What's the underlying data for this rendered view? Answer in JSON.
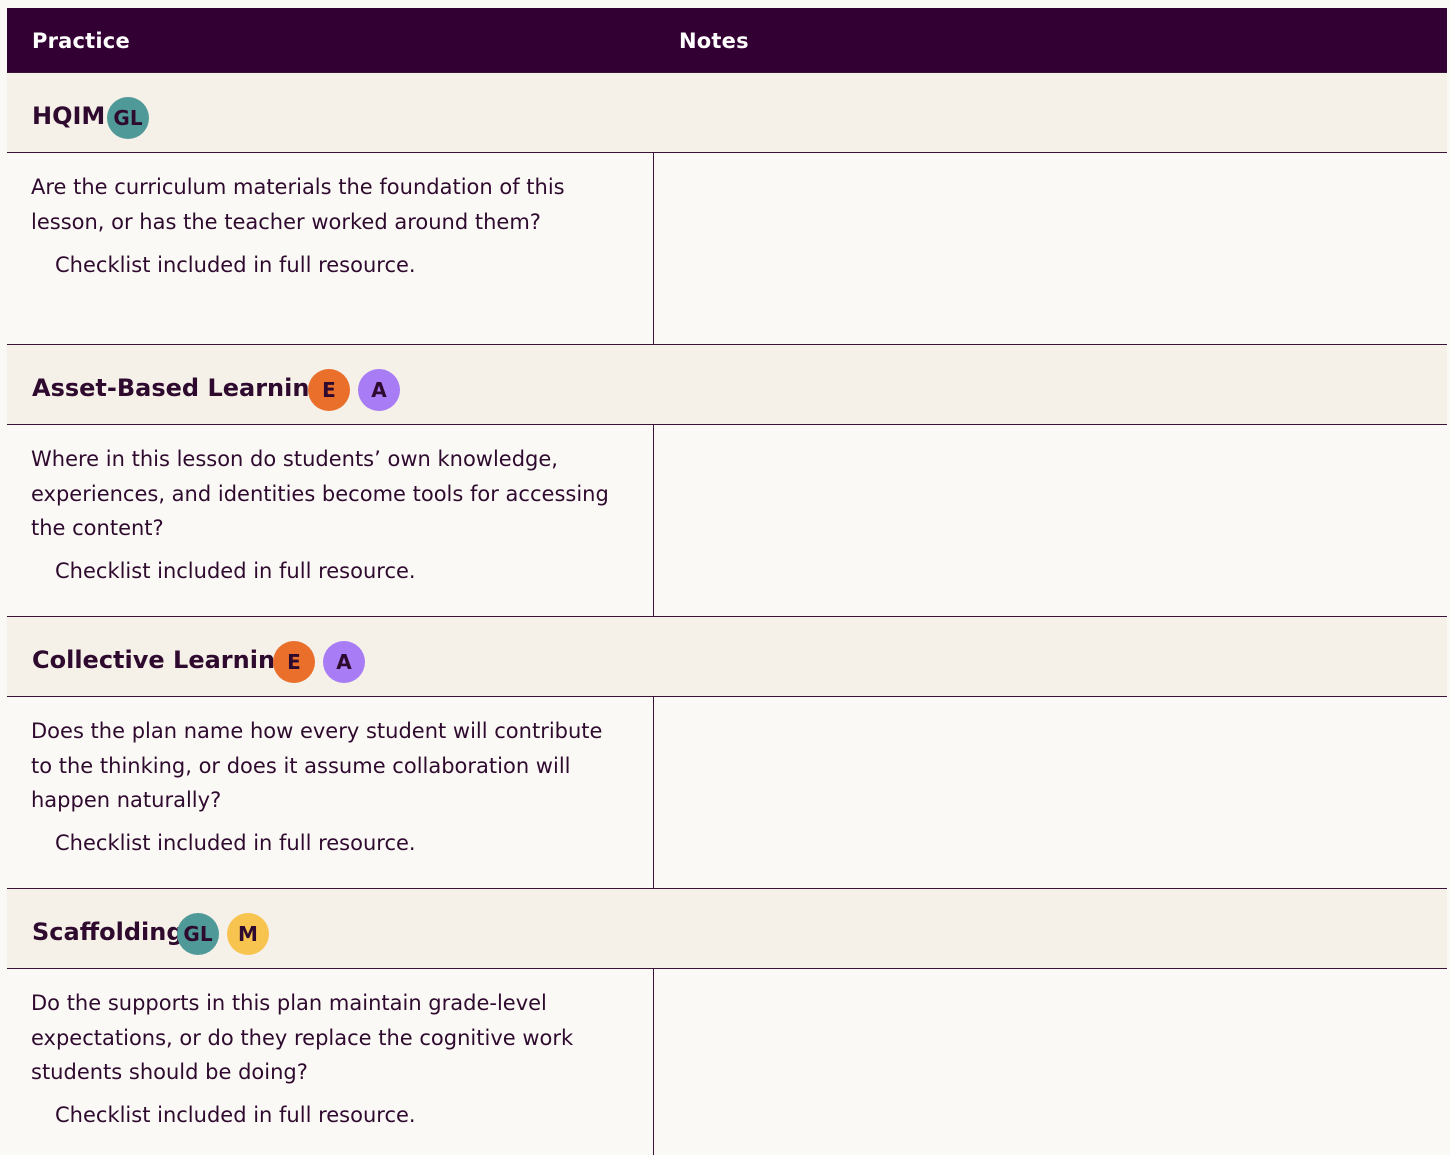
{
  "table": {
    "headers": {
      "practice": "Practice",
      "notes": "Notes"
    },
    "rows": [
      {
        "title": "HQIM",
        "badges": [
          {
            "label": "GL",
            "color": "#4f9998"
          }
        ],
        "question": "Are the curriculum materials the foundation of this lesson, or has the teacher worked around them?",
        "checklist": "Checklist included in full resource.",
        "notes": ""
      },
      {
        "title": "Asset-Based Learning",
        "badges": [
          {
            "label": "E",
            "color": "#e96f2b"
          },
          {
            "label": "A",
            "color": "#a77cf5"
          }
        ],
        "question": "Where in this lesson do students’ own knowledge, experiences, and identities become tools for accessing the content?",
        "checklist": "Checklist included in full resource.",
        "notes": ""
      },
      {
        "title": "Collective Learning",
        "badges": [
          {
            "label": "E",
            "color": "#e96f2b"
          },
          {
            "label": "A",
            "color": "#a77cf5"
          }
        ],
        "question": "Does the plan name how every student will contribute to the thinking, or does it assume collaboration will happen naturally?",
        "checklist": "Checklist included in full resource.",
        "notes": ""
      },
      {
        "title": "Scaffolding",
        "badges": [
          {
            "label": "GL",
            "color": "#4f9998"
          },
          {
            "label": "M",
            "color": "#f8c450"
          }
        ],
        "question": "Do the supports in this plan maintain grade-level expectations, or do they replace the cognitive work students should be doing?",
        "checklist": "Checklist included in full resource.",
        "notes": ""
      }
    ]
  },
  "colors": {
    "header_background": "#330033",
    "title_row_background": "#f5f0e8",
    "body_background": "#fbf9f5",
    "border": "#3b1238",
    "text": "#2f0a2f"
  }
}
